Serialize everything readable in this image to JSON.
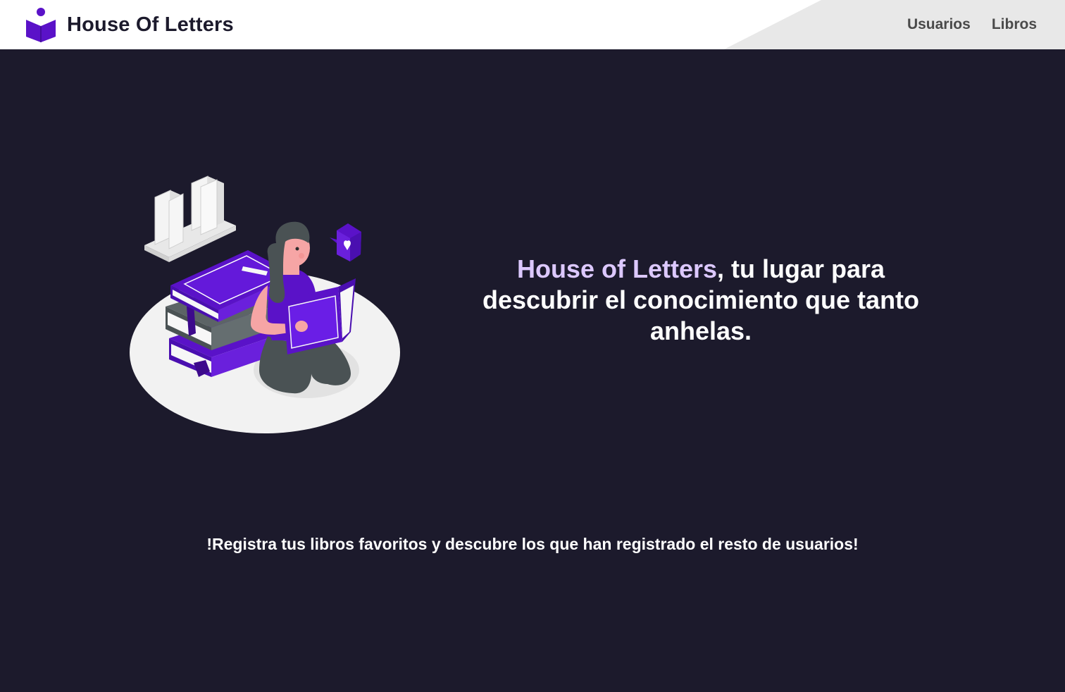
{
  "header": {
    "brand": "House Of Letters",
    "logo_icon": "reading-person-icon",
    "nav": [
      {
        "label": "Usuarios"
      },
      {
        "label": "Libros"
      }
    ]
  },
  "hero": {
    "illustration": "woman-reading-books-illustration",
    "tagline_highlight": "House of Letters",
    "tagline_rest": ", tu lugar para descubrir el conocimiento que tanto anhelas."
  },
  "cta": {
    "text": "!Registra tus libros favoritos y descubre los que han registrado el resto de usuarios!"
  },
  "colors": {
    "background": "#1c1a2c",
    "accent": "#5a12c8",
    "highlight": "#dcc8ff",
    "navbar": "#ffffff"
  }
}
